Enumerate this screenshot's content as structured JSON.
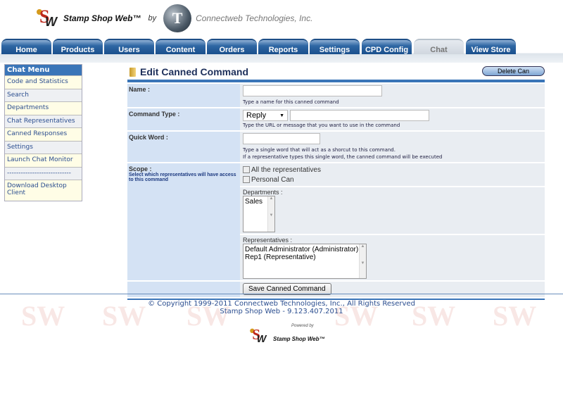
{
  "header": {
    "brand": "Stamp Shop Web™",
    "by": "by",
    "company": "Connectweb Technologies, Inc.",
    "logo_text": "SW",
    "company_logo_text": "CT"
  },
  "tabs": [
    {
      "label": "Home"
    },
    {
      "label": "Products"
    },
    {
      "label": "Users"
    },
    {
      "label": "Content"
    },
    {
      "label": "Orders"
    },
    {
      "label": "Reports"
    },
    {
      "label": "Settings"
    },
    {
      "label": "CPD Config"
    },
    {
      "label": "Chat",
      "active": true
    },
    {
      "label": "View Store"
    }
  ],
  "sidebar": {
    "title": "Chat Menu",
    "items": [
      {
        "label": "Code and Statistics"
      },
      {
        "label": "Search"
      },
      {
        "label": "Departments"
      },
      {
        "label": "Chat Representatives"
      },
      {
        "label": "Canned Responses"
      },
      {
        "label": "Settings"
      },
      {
        "label": "Launch Chat Monitor"
      },
      {
        "label": "----------------------------"
      },
      {
        "label": "Download Desktop Client"
      }
    ]
  },
  "main": {
    "title": "Edit Canned Command",
    "delete_label": "Delete Can",
    "name": {
      "label": "Name :",
      "value": "",
      "hint": "Type a name for this canned command"
    },
    "command_type": {
      "label": "Command Type :",
      "selected": "Reply",
      "value": "",
      "hint": "Type the URL or message that you want to use in the command"
    },
    "quick_word": {
      "label": "Quick Word :",
      "value": "",
      "hint1": "Type a single word that will act as a shorcut to this command.",
      "hint2": "If a representative types this single word, the canned command will be executed"
    },
    "scope": {
      "label": "Scope :",
      "sub": "Select which representatives will have access to this command",
      "all_reps": "All the representatives",
      "personal": "Personal Can",
      "departments_label": "Departments :",
      "departments": [
        "Sales"
      ],
      "reps_label": "Representatives :",
      "reps": [
        "Default Administrator (Administrator)",
        "Rep1 (Representative)"
      ]
    },
    "save_label": "Save Canned Command"
  },
  "footer": {
    "copyright": "© Copyright 1999-2011 Connectweb Technologies, Inc., All Rights Reserved",
    "version": "Stamp Shop Web - 9.123.407.2011",
    "powered_by": "Powered by",
    "powered_brand": "Stamp Shop Web™"
  },
  "colors": {
    "accent": "#3a75b8",
    "label_bg": "#d4e2f4",
    "field_bg": "#e9edf2"
  }
}
